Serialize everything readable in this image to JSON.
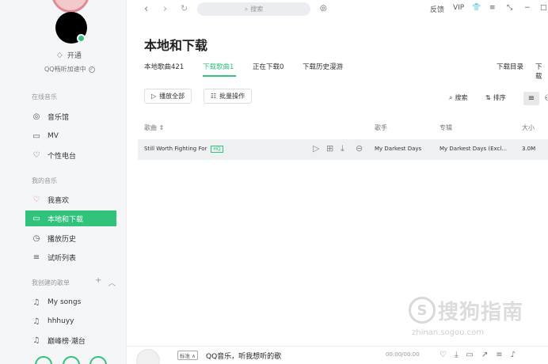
{
  "app": {
    "title": "本地和下载"
  },
  "sidebar": {
    "vip_label": "开通",
    "accel_label": "QQ畅听加速中",
    "sections": [
      {
        "title": "在线音乐",
        "items": [
          {
            "label": "音乐馆",
            "icon": "disc-icon"
          },
          {
            "label": "MV",
            "icon": "video-icon"
          },
          {
            "label": "个性电台",
            "icon": "radio-heart-icon"
          }
        ]
      },
      {
        "title": "我的音乐",
        "items": [
          {
            "label": "我喜欢",
            "icon": "heart-icon"
          },
          {
            "label": "本地和下载",
            "icon": "monitor-icon",
            "active": true
          },
          {
            "label": "播放历史",
            "icon": "clock-icon"
          },
          {
            "label": "试听列表",
            "icon": "list-icon"
          }
        ]
      },
      {
        "title": "我创建的歌单",
        "items": [
          {
            "label": "My songs",
            "icon": "music-note-icon"
          },
          {
            "label": "hhhuyy",
            "icon": "music-note-icon"
          },
          {
            "label": "巅峰榜·潮台",
            "icon": "music-note-icon"
          }
        ]
      }
    ]
  },
  "topbar": {
    "search_placeholder": "搜索",
    "feedback": "反馈",
    "vip": "VIP"
  },
  "tabs": [
    {
      "label": "本地歌曲421",
      "active": false
    },
    {
      "label": "下载歌曲1",
      "active": true
    },
    {
      "label": "正在下载0",
      "active": false
    },
    {
      "label": "下载历史漫游",
      "active": false
    }
  ],
  "tabs_right": {
    "download_dir": "下载目录",
    "download_more": "下载"
  },
  "toolbar": {
    "play_all": "播放全部",
    "batch": "批量操作",
    "search": "搜索",
    "sort": "排序"
  },
  "columns": {
    "song": "歌曲",
    "artist": "歌手",
    "album": "专辑",
    "size": "大小"
  },
  "songs": [
    {
      "title": "Still Worth Fighting For",
      "quality": "HQ",
      "artist": "My Darkest Days",
      "album": "My Darkest Days (Excl...",
      "size": "3.0M"
    }
  ],
  "player": {
    "quality": "标准",
    "title": "QQ音乐，听我想听的歌",
    "time": "00:00/00:00"
  },
  "watermark": {
    "logo_char": "S",
    "text": "搜狗指南",
    "url": "zhinan.sogou.com"
  }
}
